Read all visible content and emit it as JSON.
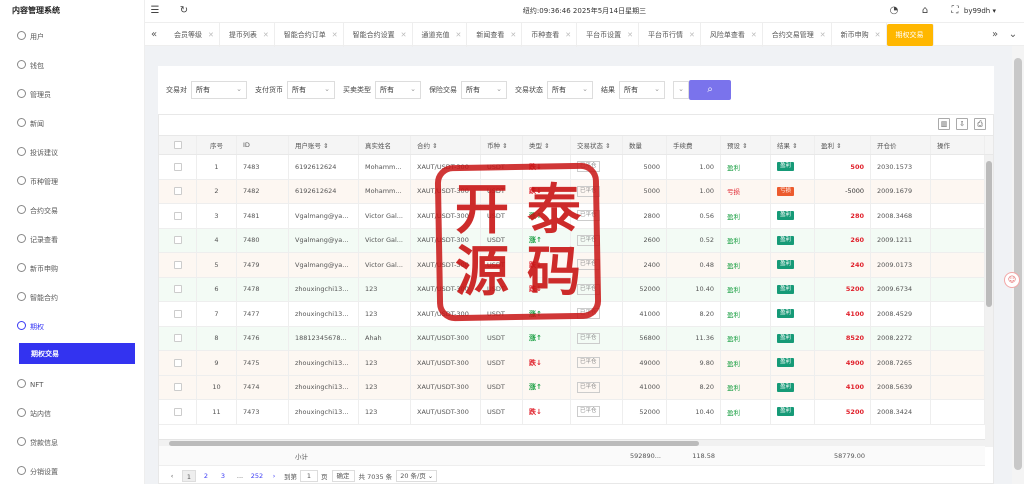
{
  "app": {
    "title": "内容管理系统"
  },
  "sidebar": {
    "items": [
      {
        "label": "用户",
        "icon": "user-icon"
      },
      {
        "label": "钱包",
        "icon": "wallet-icon"
      },
      {
        "label": "管理员",
        "icon": "admin-icon"
      },
      {
        "label": "新闻",
        "icon": "news-icon"
      },
      {
        "label": "投诉建议",
        "icon": "feedback-icon"
      },
      {
        "label": "币种管理",
        "icon": "coin-icon"
      },
      {
        "label": "合约交易",
        "icon": "contract-icon"
      },
      {
        "label": "记录查看",
        "icon": "record-icon"
      },
      {
        "label": "新币申购",
        "icon": "subscribe-icon"
      },
      {
        "label": "智能合约",
        "icon": "smart-contract-icon"
      },
      {
        "label": "期权",
        "icon": "option-icon"
      }
    ],
    "active_sub": "期权交易",
    "items_after": [
      {
        "label": "NFT",
        "icon": "nft-icon"
      },
      {
        "label": "站内信",
        "icon": "message-icon"
      },
      {
        "label": "贷款信息",
        "icon": "loan-icon"
      },
      {
        "label": "分销设置",
        "icon": "distribution-icon"
      }
    ]
  },
  "topbar": {
    "datetime": "纽约:09:36:46 2025年5月14日星期三",
    "user": "by99dh"
  },
  "tabs": [
    "会员等级",
    "提币列表",
    "智能合约订单",
    "智能合约设置",
    "通道充值",
    "新闻查看",
    "币种查看",
    "平台币设置",
    "平台币行情",
    "风险单查看",
    "合约交易管理",
    "新币申购"
  ],
  "active_tab": "期权交易",
  "filters": [
    {
      "label": "交易对",
      "value": "所有"
    },
    {
      "label": "支付货币",
      "value": "所有"
    },
    {
      "label": "买卖类型",
      "value": "所有"
    },
    {
      "label": "保险交易",
      "value": "所有"
    },
    {
      "label": "交易状态",
      "value": "所有"
    },
    {
      "label": "结果",
      "value": "所有"
    }
  ],
  "table": {
    "headers": [
      "序号",
      "ID",
      "用户账号 ⇕",
      "真实姓名",
      "合约 ⇕",
      "币种 ⇕",
      "类型 ⇕",
      "交易状态 ⇕",
      "数量",
      "手续费",
      "预设 ⇕",
      "结果 ⇕",
      "盈利 ⇕",
      "开仓价",
      "操作"
    ],
    "rows": [
      {
        "no": "1",
        "id": "7483",
        "account": "6192612624",
        "name": "Mohamm...",
        "contract": "XAUT/USDT-300",
        "coin": "USDT",
        "type": "跌↓",
        "dir": "down",
        "status": "已平仓",
        "qty": "5000",
        "fee": "1.00",
        "preset": "盈利",
        "preset_kind": "win",
        "result": "盈利",
        "result_kind": "win",
        "profit": "500",
        "price": "2030.1573"
      },
      {
        "no": "2",
        "id": "7482",
        "account": "6192612624",
        "name": "Mohamm...",
        "contract": "XAUT/USDT-300",
        "coin": "USDT",
        "type": "跌↓",
        "dir": "down",
        "status": "已平仓",
        "qty": "5000",
        "fee": "1.00",
        "preset": "亏损",
        "preset_kind": "lose",
        "result": "亏损",
        "result_kind": "lose",
        "profit": "-5000",
        "price": "2009.1679"
      },
      {
        "no": "3",
        "id": "7481",
        "account": "Vgalmang@ya...",
        "name": "Victor Gal...",
        "contract": "XAUT/USDT-300",
        "coin": "USDT",
        "type": "涨↑",
        "dir": "up",
        "status": "已平仓",
        "qty": "2800",
        "fee": "0.56",
        "preset": "盈利",
        "preset_kind": "win",
        "result": "盈利",
        "result_kind": "win",
        "profit": "280",
        "price": "2008.3468"
      },
      {
        "no": "4",
        "id": "7480",
        "account": "Vgalmang@ya...",
        "name": "Victor Gal...",
        "contract": "XAUT/USDT-300",
        "coin": "USDT",
        "type": "涨↑",
        "dir": "up",
        "status": "已平仓",
        "qty": "2600",
        "fee": "0.52",
        "preset": "盈利",
        "preset_kind": "win",
        "result": "盈利",
        "result_kind": "win",
        "profit": "260",
        "price": "2009.1211"
      },
      {
        "no": "5",
        "id": "7479",
        "account": "Vgalmang@ya...",
        "name": "Victor Gal...",
        "contract": "XAUT/USDT-300",
        "coin": "USDT",
        "type": "跌↓",
        "dir": "down",
        "status": "已平仓",
        "qty": "2400",
        "fee": "0.48",
        "preset": "盈利",
        "preset_kind": "win",
        "result": "盈利",
        "result_kind": "win",
        "profit": "240",
        "price": "2009.0173"
      },
      {
        "no": "6",
        "id": "7478",
        "account": "zhouxingchi13...",
        "name": "123",
        "contract": "XAUT/USDT-300",
        "coin": "USDT",
        "type": "跌↓",
        "dir": "down",
        "status": "已平仓",
        "qty": "52000",
        "fee": "10.40",
        "preset": "盈利",
        "preset_kind": "win",
        "result": "盈利",
        "result_kind": "win",
        "profit": "5200",
        "price": "2009.6734"
      },
      {
        "no": "7",
        "id": "7477",
        "account": "zhouxingchi13...",
        "name": "123",
        "contract": "XAUT/USDT-300",
        "coin": "USDT",
        "type": "涨↑",
        "dir": "up",
        "status": "已平仓",
        "qty": "41000",
        "fee": "8.20",
        "preset": "盈利",
        "preset_kind": "win",
        "result": "盈利",
        "result_kind": "win",
        "profit": "4100",
        "price": "2008.4529"
      },
      {
        "no": "8",
        "id": "7476",
        "account": "18812345678...",
        "name": "Ahah",
        "contract": "XAUT/USDT-300",
        "coin": "USDT",
        "type": "涨↑",
        "dir": "up",
        "status": "已平仓",
        "qty": "56800",
        "fee": "11.36",
        "preset": "盈利",
        "preset_kind": "win",
        "result": "盈利",
        "result_kind": "win",
        "profit": "8520",
        "price": "2008.2272"
      },
      {
        "no": "9",
        "id": "7475",
        "account": "zhouxingchi13...",
        "name": "123",
        "contract": "XAUT/USDT-300",
        "coin": "USDT",
        "type": "跌↓",
        "dir": "down",
        "status": "已平仓",
        "qty": "49000",
        "fee": "9.80",
        "preset": "盈利",
        "preset_kind": "win",
        "result": "盈利",
        "result_kind": "win",
        "profit": "4900",
        "price": "2008.7265"
      },
      {
        "no": "10",
        "id": "7474",
        "account": "zhouxingchi13...",
        "name": "123",
        "contract": "XAUT/USDT-300",
        "coin": "USDT",
        "type": "涨↑",
        "dir": "up",
        "status": "已平仓",
        "qty": "41000",
        "fee": "8.20",
        "preset": "盈利",
        "preset_kind": "win",
        "result": "盈利",
        "result_kind": "win",
        "profit": "4100",
        "price": "2008.5639"
      },
      {
        "no": "11",
        "id": "7473",
        "account": "zhouxingchi13...",
        "name": "123",
        "contract": "XAUT/USDT-300",
        "coin": "USDT",
        "type": "跌↓",
        "dir": "down",
        "status": "已平仓",
        "qty": "52000",
        "fee": "10.40",
        "preset": "盈利",
        "preset_kind": "win",
        "result": "盈利",
        "result_kind": "win",
        "profit": "5200",
        "price": "2008.3424"
      }
    ],
    "summary": {
      "label": "小计",
      "qty": "592890...",
      "fee": "118.58",
      "profit": "58779.00"
    }
  },
  "pagination": {
    "pages": [
      "1",
      "2",
      "3",
      "...",
      "252"
    ],
    "goto_label": "到第",
    "goto_value": "1",
    "page_unit": "页",
    "confirm": "确定",
    "total": "共 7035 条",
    "page_size": "20 条/页"
  },
  "watermark": {
    "text": "开泰源码"
  }
}
